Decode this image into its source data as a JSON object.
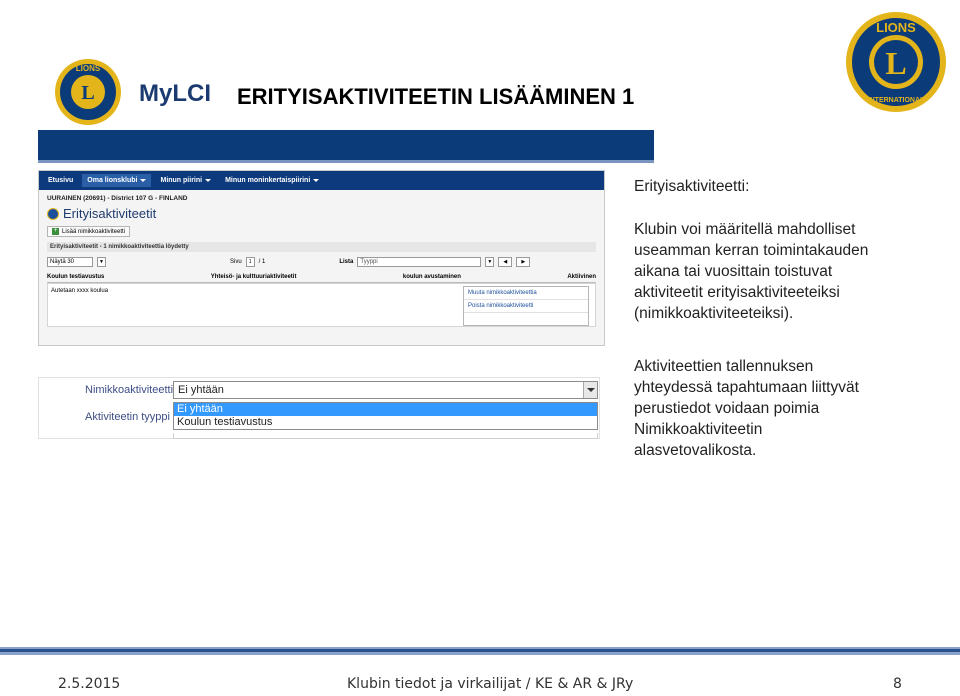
{
  "header": {
    "brand": "MyLCI",
    "title": "ERITYISAKTIVITEETIN LISÄÄMINEN 1",
    "logo_text_top": "LIONS",
    "logo_text_bottom": "INTERNATIONAL",
    "logo_letter": "L"
  },
  "screenshot1": {
    "nav": [
      "Etusivu",
      "Oma lionsklubi",
      "Minun piirini",
      "Minun moninkertaispiirini"
    ],
    "club_line": "UURAINEN (20691) - District 107 G - FINLAND",
    "section_title": "Erityisaktiviteetit",
    "add_button": "Lisää nimikkoaktiviteetti",
    "grid_header": "Erityisaktiviteetit - 1 nimikkoaktiviteettia löydetty",
    "show_label": "Näytä 30",
    "page_label": "Sivu",
    "page_current": "1",
    "page_total": "/ 1",
    "list_label": "Lista",
    "list_value": "Tyyppi",
    "columns": [
      "Koulun testiavustus",
      "Yhteisö- ja kulttuuriaktiviteetit",
      "koulun avustaminen",
      "Aktiivinen"
    ],
    "row_text": "Autetaan xxxx koulua",
    "menu": [
      "Muuta nimikkoaktiviteettia",
      "Poista nimikkoaktiviteetti"
    ]
  },
  "screenshot2": {
    "label1": "Nimikkoaktiviteetti",
    "label2": "Aktiviteetin tyyppi",
    "dropdown_value": "Ei yhtään",
    "options": [
      "Ei yhtään",
      "Koulun testiavustus"
    ]
  },
  "description": {
    "heading": "Erityisaktiviteetti:",
    "para1": [
      "Klubin voi määritellä mahdolliset",
      "useamman kerran toimintakauden",
      "aikana tai vuosittain toistuvat",
      "aktiviteetit erityisaktiviteeteiksi",
      "(nimikkoaktiviteeteiksi)."
    ],
    "para2": [
      "Aktiviteettien tallennuksen",
      "yhteydessä tapahtumaan liittyvät",
      "perustiedot voidaan poimia",
      "Nimikkoaktiviteetin",
      "alasvetovalikosta."
    ]
  },
  "footer": {
    "date": "2.5.2015",
    "center": "Klubin tiedot ja virkailijat / KE & AR & JRy",
    "page": "8"
  },
  "colors": {
    "navy": "#0c3b7a",
    "gold": "#e3b51b",
    "link": "#1c4f9c",
    "selection": "#3399ff"
  }
}
